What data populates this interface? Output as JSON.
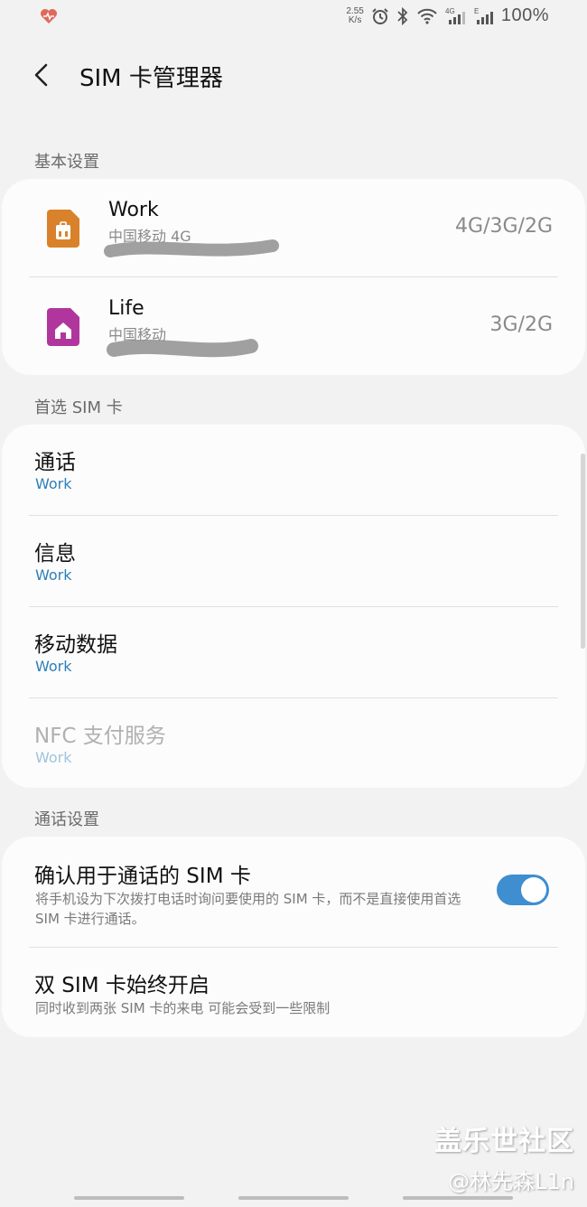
{
  "status_bar": {
    "net_speed_value": "2.55",
    "net_speed_unit": "K/s",
    "battery": "100%",
    "icons": [
      "health-heart-icon",
      "alarm-icon",
      "bluetooth-icon",
      "wifi-icon",
      "signal-4g-icon",
      "signal-e-icon"
    ]
  },
  "header": {
    "title": "SIM 卡管理器"
  },
  "sections": {
    "basic": "基本设置",
    "preferred": "首选 SIM 卡",
    "call": "通话设置"
  },
  "sims": [
    {
      "name": "Work",
      "carrier": "中国移动 4G",
      "network": "4G/3G/2G",
      "icon_color": "#d9822b",
      "icon": "sim-card-work-icon"
    },
    {
      "name": "Life",
      "carrier": "中国移动",
      "network": "3G/2G",
      "icon_color": "#b0369e",
      "icon": "sim-card-home-icon"
    }
  ],
  "preferred": [
    {
      "label": "通话",
      "value": "Work"
    },
    {
      "label": "信息",
      "value": "Work"
    },
    {
      "label": "移动数据",
      "value": "Work"
    },
    {
      "label": "NFC 支付服务",
      "value": "Work"
    }
  ],
  "call_settings": {
    "confirm_title": "确认用于通话的 SIM 卡",
    "confirm_desc": "将手机设为下次拨打电话时询问要使用的 SIM 卡，而不是直接使用首选 SIM 卡进行通话。",
    "confirm_enabled": true,
    "dual_title": "双 SIM 卡始终开启",
    "dual_desc": "同时收到两张 SIM 卡的来电 可能会受到一些限制"
  },
  "colors": {
    "accent": "#3e8ed0",
    "link_blue": "#2d7fb8"
  },
  "watermark": {
    "line1": "盖乐世社区",
    "line2": "@林先森L1n"
  }
}
